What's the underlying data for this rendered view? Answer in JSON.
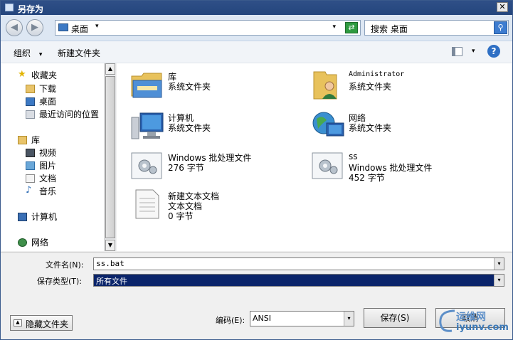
{
  "window": {
    "title": "另存为",
    "close_glyph": "✕"
  },
  "nav": {
    "back_glyph": "◀",
    "forward_glyph": "▶",
    "address": "桌面",
    "address_dropdown": "▾",
    "history_dropdown": "▾",
    "refresh_glyph": "⇄",
    "search_placeholder": "搜索 桌面",
    "search_glyph": "⚲"
  },
  "toolbar": {
    "organize": "组织",
    "organize_arrow": "▾",
    "new_folder": "新建文件夹",
    "view_arrow": "▾",
    "help": "?"
  },
  "sidebar": {
    "favorites": "收藏夹",
    "downloads": "下载",
    "desktop": "桌面",
    "recent": "最近访问的位置",
    "libraries": "库",
    "videos": "视频",
    "pictures": "图片",
    "documents": "文档",
    "music": "音乐",
    "computer": "计算机",
    "network": "网络"
  },
  "files": [
    {
      "name": "库",
      "line2": "系统文件夹",
      "line3": "",
      "icon": "library-folder-icon"
    },
    {
      "name": "Administrator",
      "line2": "系统文件夹",
      "line3": "",
      "icon": "user-folder-icon"
    },
    {
      "name": "计算机",
      "line2": "系统文件夹",
      "line3": "",
      "icon": "computer-icon"
    },
    {
      "name": "网络",
      "line2": "系统文件夹",
      "line3": "",
      "icon": "network-icon"
    },
    {
      "name": "Windows 批处理文件",
      "line2": "276 字节",
      "line3": "",
      "icon": "batch-file-icon"
    },
    {
      "name": "ss",
      "line2": "Windows 批处理文件",
      "line3": "452 字节",
      "icon": "batch-file-icon"
    },
    {
      "name": "新建文本文档",
      "line2": "文本文档",
      "line3": "0 字节",
      "icon": "text-file-icon"
    }
  ],
  "form": {
    "filename_label": "文件名(N):",
    "filename_value": "ss.bat",
    "filetype_label": "保存类型(T):",
    "filetype_value": "所有文件",
    "encoding_label": "编码(E):",
    "encoding_value": "ANSI",
    "dropdown_arrow": "▾",
    "save": "保存(S)",
    "cancel": "取消",
    "hide_folders": "隐藏文件夹",
    "hide_folders_glyph": "▲"
  },
  "watermark": {
    "line1": "运维网",
    "line2": "iyunv.com"
  },
  "scroll": {
    "up": "▲",
    "down": "▼"
  },
  "colors": {
    "title_bar": "#24467d",
    "selection": "#0a246a"
  }
}
